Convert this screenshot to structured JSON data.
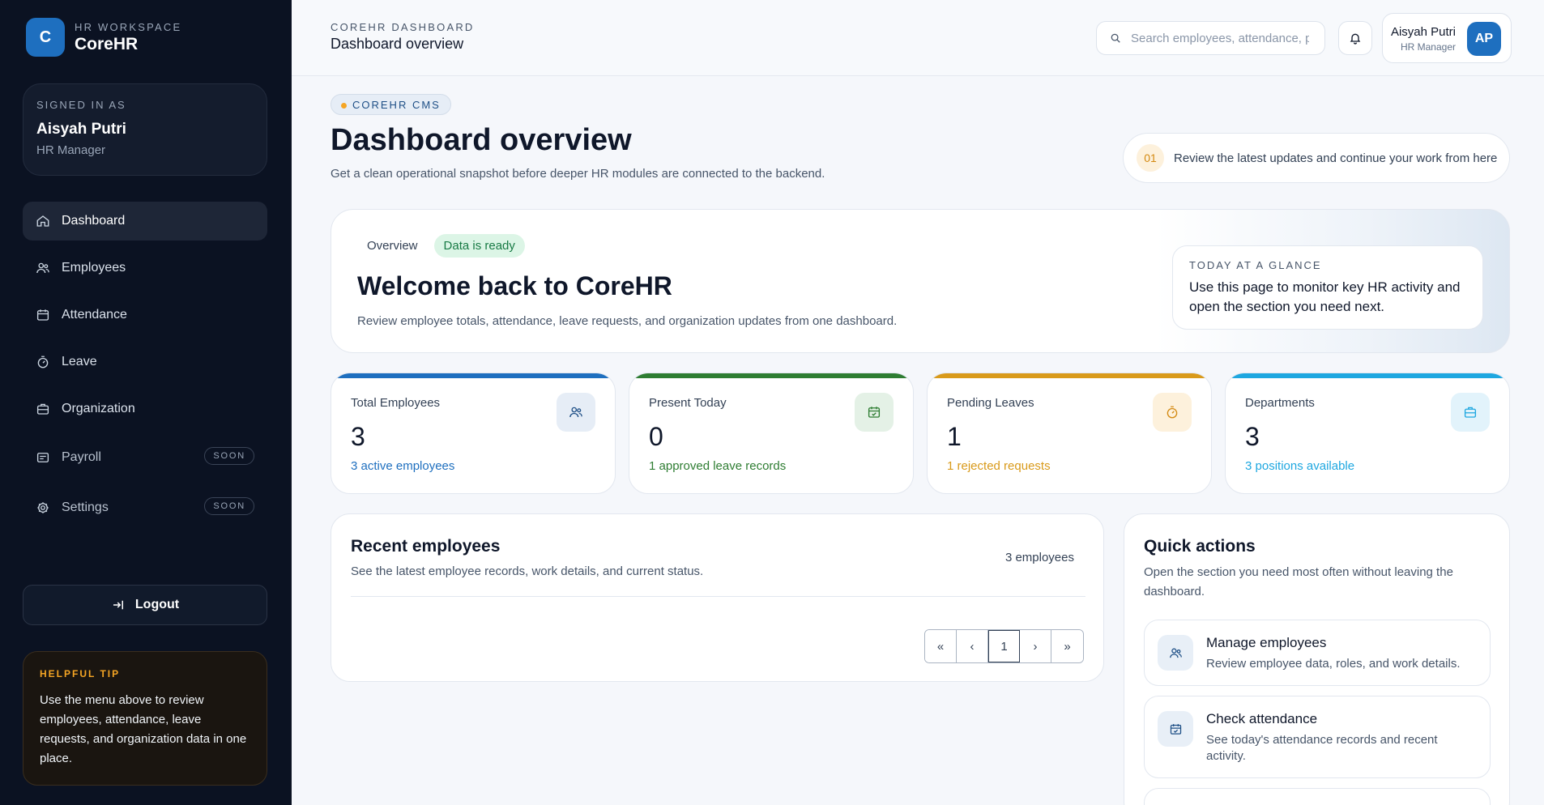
{
  "brand": {
    "logo_letter": "C",
    "subtitle": "HR WORKSPACE",
    "title": "CoreHR"
  },
  "signed_in": {
    "label": "SIGNED IN AS",
    "name": "Aisyah Putri",
    "role": "HR Manager"
  },
  "nav": {
    "items": [
      {
        "label": "Dashboard",
        "icon": "home-icon",
        "active": true
      },
      {
        "label": "Employees",
        "icon": "users-icon"
      },
      {
        "label": "Attendance",
        "icon": "calendar-icon"
      },
      {
        "label": "Leave",
        "icon": "timer-icon"
      },
      {
        "label": "Organization",
        "icon": "briefcase-icon"
      },
      {
        "label": "Payroll",
        "icon": "wallet-icon",
        "badge": "SOON"
      },
      {
        "label": "Settings",
        "icon": "gear-icon",
        "badge": "SOON"
      }
    ]
  },
  "logout": {
    "label": "Logout"
  },
  "tip": {
    "label": "HELPFUL TIP",
    "text": "Use the menu above to review employees, attendance, leave requests, and organization data in one place."
  },
  "header": {
    "subtitle": "COREHR DASHBOARD",
    "title": "Dashboard overview",
    "search_placeholder": "Search employees, attendance, p",
    "user_name": "Aisyah Putri",
    "user_role": "HR Manager",
    "avatar_initials": "AP"
  },
  "hero": {
    "pill": "COREHR CMS",
    "title": "Dashboard overview",
    "subtitle": "Get a clean operational snapshot before deeper HR modules are connected to the backend.",
    "step_number": "01",
    "step_text": "Review the latest updates and continue your work from here"
  },
  "welcome": {
    "tab": "Overview",
    "badge": "Data is ready",
    "title": "Welcome back to CoreHR",
    "subtitle": "Review employee totals, attendance, leave requests, and organization updates from one dashboard.",
    "glance_label": "TODAY AT A GLANCE",
    "glance_text": "Use this page to monitor key HR activity and open the section you need next."
  },
  "stats": [
    {
      "label": "Total Employees",
      "value": "3",
      "note": "3 active employees",
      "accent": "#1e6fbf",
      "icon": "users-icon",
      "icon_bg": "#e6edf6",
      "icon_color": "#1e4f86"
    },
    {
      "label": "Present Today",
      "value": "0",
      "note": "1 approved leave records",
      "accent": "#2e7d32",
      "icon": "calendar-icon",
      "icon_bg": "#e4f1e6",
      "icon_color": "#2e7d32"
    },
    {
      "label": "Pending Leaves",
      "value": "1",
      "note": "1 rejected requests",
      "accent": "#d99a1a",
      "icon": "timer-icon",
      "icon_bg": "#fdf1dc",
      "icon_color": "#d48a12"
    },
    {
      "label": "Departments",
      "value": "3",
      "note": "3 positions available",
      "accent": "#1ea7e0",
      "icon": "briefcase-icon",
      "icon_bg": "#e2f3fb",
      "icon_color": "#1ea7e0"
    }
  ],
  "recent": {
    "title": "Recent employees",
    "subtitle": "See the latest employee records, work details, and current status.",
    "count": "3 employees",
    "pager": [
      "«",
      "‹",
      "1",
      "›",
      "»"
    ]
  },
  "quick": {
    "title": "Quick actions",
    "subtitle": "Open the section you need most often without leaving the dashboard.",
    "items": [
      {
        "name": "Manage employees",
        "desc": "Review employee data, roles, and work details.",
        "icon": "users-icon"
      },
      {
        "name": "Check attendance",
        "desc": "See today's attendance records and recent activity.",
        "icon": "calendar-icon"
      }
    ]
  }
}
